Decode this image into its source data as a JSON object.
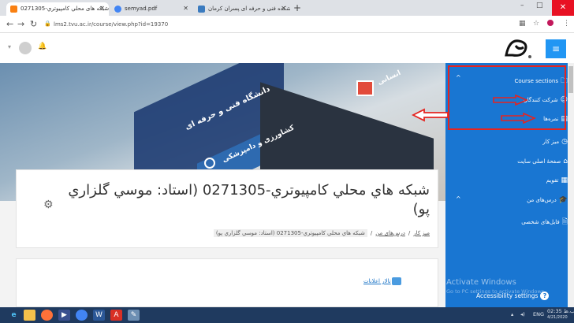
{
  "browser": {
    "tabs": [
      {
        "title": "درس: شبکه های محلي کامپيوتري-0271305...",
        "active": true
      },
      {
        "title": "semyad.pdf",
        "active": false
      },
      {
        "title": "آموزشکده فنی و حرفه ای پسران کرمان",
        "active": false
      }
    ],
    "url": "lms2.tvu.ac.ir/course/view.php?id=19370",
    "new_tab": "+"
  },
  "banner": {
    "text1": "دانشگاه فنی و حرفه ای",
    "text2": "کشاورزی و دامپزشکی",
    "text3": "انسانی"
  },
  "course": {
    "title": "شبکه هاي محلي کامپيوتري-0271305 (استاد: موسي گلزاري پو)",
    "breadcrumb": [
      "میز کار",
      "درس‌های من",
      "شبکه هاي محلي کامپيوتري-0271305 (استاد: موسي گلزاري پو)"
    ],
    "forum_link": "تالار اعلانات"
  },
  "drawer": {
    "items": [
      {
        "label": "Course sections",
        "icon": "folder-icon"
      },
      {
        "label": "شرکت کنندگان",
        "icon": "users-icon"
      },
      {
        "label": "نمره‌ها",
        "icon": "grades-table-icon"
      },
      {
        "label": "میز کار",
        "icon": "dashboard-icon"
      },
      {
        "label": "صفحهٔ اصلی سایت",
        "icon": "home-icon"
      },
      {
        "label": "تقویم",
        "icon": "calendar-icon"
      },
      {
        "label": "درس‌های من",
        "icon": "graduation-cap-icon"
      },
      {
        "label": "فایل‌های شخصی",
        "icon": "file-icon"
      }
    ],
    "accessibility": "Accessibility settings"
  },
  "watermark": {
    "line1": "Activate Windows",
    "line2": "Go to PC settings to activate Windows."
  },
  "taskbar": {
    "lang": "ENG",
    "time": "02:35 ب.ظ",
    "date": "4/21/2020"
  },
  "colors": {
    "drawer_bg": "#1976d2",
    "highlight": "#e52420",
    "taskbar_bg": "#1f3a5f"
  }
}
